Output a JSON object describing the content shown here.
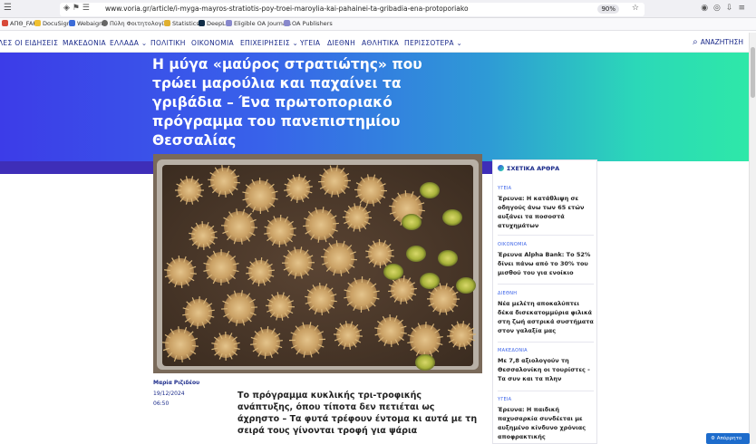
{
  "browser": {
    "url": "www.voria.gr/article/i-myga-mayros-stratiotis-poy-troei-maroylia-kai-pahainei-ta-gribadia-ena-protoporiako",
    "zoom": "90%"
  },
  "bookmarks": [
    {
      "label": "ΑΠΘ_FAKE",
      "color": "#d84a3a"
    },
    {
      "label": "DocuSign",
      "color": "#f0c030"
    },
    {
      "label": "Webaign",
      "color": "#3b6bd8"
    },
    {
      "label": "Πύλη Φοιτητολογίου",
      "color": "#666666"
    },
    {
      "label": "Statistics",
      "color": "#e0b030"
    },
    {
      "label": "DeepL",
      "color": "#0f2b46"
    },
    {
      "label": "Eligible OA Journals",
      "color": "#8888cc"
    },
    {
      "label": "OA Publishers",
      "color": "#8888cc"
    }
  ],
  "nav": {
    "items": [
      "ΛΕΣ ΟΙ ΕΙΔΗΣΕΙΣ",
      "ΜΑΚΕΔΟΝΙΑ",
      "ΕΛΛΑΔΑ ⌄",
      "ΠΟΛΙΤΙΚΗ",
      "ΟΙΚΟΝΟΜΙΑ",
      "ΕΠΙΧΕΙΡΗΣΕΙΣ ⌄",
      "ΥΓΕΙΑ",
      "ΔΙΕΘΝΗ",
      "ΑΘΛΗΤΙΚΑ",
      "ΠΕΡΙΣΣΟΤΕΡΑ ⌄"
    ],
    "search_label": "ΑΝΑΖΗΤΗΣΗ"
  },
  "article": {
    "headline": "Η μύγα «μαύρος στρατιώτης» που τρώει μαρούλια και παχαίνει τα γριβάδια – Ένα πρωτοποριακό πρόγραμμα του πανεπιστημίου Θεσσαλίας",
    "author": "Μαρία Ριζιδέου",
    "date": "19/12/2024",
    "time": "06:50",
    "lead": "Το πρόγραμμα κυκλικής τρι-τροφικής ανάπτυξης, όπου τίποτα δεν πετιέται ως άχρηστο – Τα φυτά τρέφουν έντομα κι αυτά με τη σειρά τους γίνονται τροφή για ψάρια"
  },
  "sidebar": {
    "heading": "ΣΧΕΤΙΚΑ ΑΡΘΡΑ",
    "items": [
      {
        "category": "ΥΓΕΙΑ",
        "title": "Έρευνα: Η κατάθλιψη σε οδηγούς άνω των 65 ετών αυξάνει τα ποσοστά ατυχημάτων"
      },
      {
        "category": "ΟΙΚΟΝΟΜΙΑ",
        "title": "Έρευνα Alpha Bank: Το 52% δίνει πάνω από το 30% του μισθού του για ενοίκιο"
      },
      {
        "category": "ΔΙΕΘΝΗ",
        "title": "Νέα μελέτη αποκαλύπτει δέκα δισεκατομμύρια φιλικά στη ζωή αστρικά συστήματα στον γαλαξία μας"
      },
      {
        "category": "ΜΑΚΕΔΟΝΙΑ",
        "title": "Με 7,8 αξιολογούν τη Θεσσαλονίκη οι τουρίστες - Τα συν και τα πλην"
      },
      {
        "category": "ΥΓΕΙΑ",
        "title": "Έρευνα: Η παιδική παχυσαρκία συνδέεται με αυξημένο κίνδυνο χρόνιας αποφρακτικής πνευμονοπάθειας"
      }
    ]
  },
  "accessibility_label": "Απόρρητο"
}
